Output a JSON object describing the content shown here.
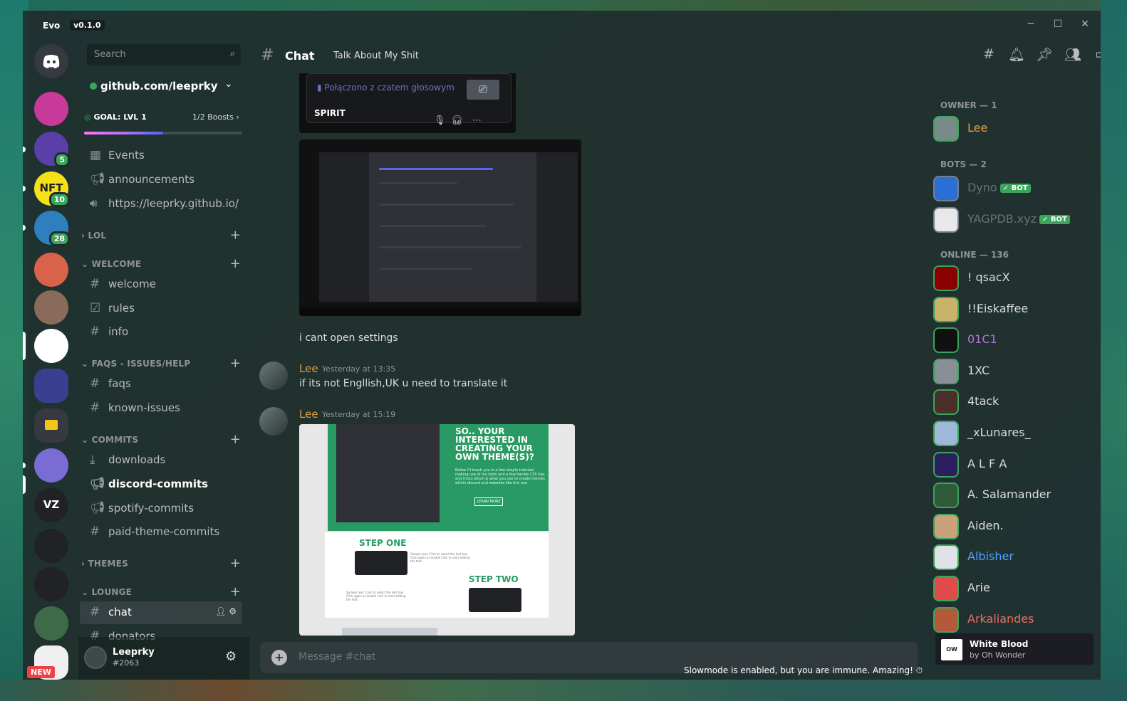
{
  "app": {
    "name": "Evo",
    "version": "v0.1.0"
  },
  "window_controls": {
    "minimize": "─",
    "maximize": "☐",
    "close": "✕"
  },
  "rail": {
    "home_icon": "discord-logo-icon",
    "servers": [
      {
        "name": "server-w",
        "color": "#c83a9a",
        "badge": ""
      },
      {
        "name": "server-night",
        "color": "#5b3fa8",
        "badge": "5"
      },
      {
        "name": "server-nft",
        "color": "#f5e11a",
        "badge": "10",
        "label": "NFT"
      },
      {
        "name": "server-calendar",
        "color": "#2f7fbf",
        "badge": "28"
      },
      {
        "name": "server-sunset",
        "color": "#d8634a",
        "badge": ""
      },
      {
        "name": "server-heroes",
        "color": "#8a6b5a",
        "badge": ""
      },
      {
        "name": "server-goose",
        "color": "#ffffff",
        "badge": ""
      },
      {
        "name": "server-folder",
        "color": "#3a3f8f",
        "badge": ""
      },
      {
        "name": "server-yellow-folder",
        "color": "#36393f",
        "badge": ""
      },
      {
        "name": "server-plug",
        "color": "#7a6bd5",
        "badge": ""
      },
      {
        "name": "server-vz",
        "color": "#202225",
        "badge": "",
        "label": "VZ"
      },
      {
        "name": "server-bd1",
        "color": "#202225",
        "badge": ""
      },
      {
        "name": "server-bd2",
        "color": "#202225",
        "badge": ""
      },
      {
        "name": "server-goose2",
        "color": "#3d6b4a",
        "badge": ""
      },
      {
        "name": "server-new",
        "color": "#f0f0f0",
        "badge": "NEW"
      }
    ]
  },
  "sidebar": {
    "search_placeholder": "Search",
    "server_name": "github.com/leeprky",
    "goal": "GOAL: LVL 1",
    "boosts": "1/2 Boosts",
    "goal_progress": 0.5,
    "channels": [
      {
        "icon": "▤",
        "label": "Events",
        "style": ""
      },
      {
        "icon": "📢",
        "label": "announcements",
        "style": ""
      },
      {
        "icon": "🔊",
        "label": "https://leeprky.github.io/",
        "style": ""
      }
    ],
    "categories": {
      "lol": "LOL",
      "welcome": "WELCOME",
      "faqs": "FAQS - ISSUES/HELP",
      "commits": "COMMITS",
      "themes": "THEMES",
      "lounge": "LOUNGE"
    },
    "welcome_channels": [
      "welcome",
      "rules",
      "info"
    ],
    "faq_channels": [
      "faqs",
      "known-issues"
    ],
    "commit_channels": [
      "downloads",
      "discord-commits",
      "spotify-commits",
      "paid-theme-commits"
    ],
    "lounge_channels": [
      "chat",
      "donators"
    ]
  },
  "user": {
    "name": "Leeprky",
    "tag": "#2063"
  },
  "header": {
    "title": "Chat",
    "topic": "Talk About My Shit"
  },
  "messages": {
    "voice_embed_status": "Połączono z czatem głosowym",
    "voice_embed_name": "SPIRIT",
    "text1": "i cant open settings",
    "author": "Lee",
    "time1": "Yesterday at 13:35",
    "text2": "if its not Engllish,UK u need to translate it",
    "time2": "Yesterday at 15:19",
    "shot2": {
      "headline": "SO.. YOUR INTERESTED IN CREATING YOUR OWN THEME(S)?",
      "body": "Below I'll teach you in a few simple tutorials making use of my tools and a few handle CSS tips and tricks which is what you use to create themes within discord and websites like this one",
      "button": "LEARN MORE",
      "step1": "STEP ONE",
      "step2": "STEP TWO",
      "sample": "Sample text. Click to select the text box. Click again or double click to start editing the text."
    }
  },
  "composer": {
    "placeholder": "Message #chat"
  },
  "slowmode": "Slowmode is enabled, but you are immune. Amazing!",
  "members": {
    "owner_header": "OWNER — 1",
    "bots_header": "BOTS — 2",
    "online_header": "ONLINE — 136",
    "bot_label": "✓ BOT",
    "owner": [
      {
        "name": "Lee",
        "color": "#e0a040"
      }
    ],
    "bots": [
      {
        "name": "Dyno",
        "color": "#6a7174"
      },
      {
        "name": "YAGPDB.xyz",
        "color": "#6a7174"
      }
    ],
    "online": [
      {
        "name": "! qsacX",
        "color": "#dcddde"
      },
      {
        "name": "!!Eiskaffee",
        "color": "#dcddde"
      },
      {
        "name": "01C1",
        "color": "#b56fd8"
      },
      {
        "name": "1XC",
        "color": "#dcddde"
      },
      {
        "name": "4tack",
        "color": "#dcddde"
      },
      {
        "name": "_xLunares_",
        "color": "#dcddde"
      },
      {
        "name": "A L F A",
        "color": "#dcddde"
      },
      {
        "name": "A. Salamander",
        "color": "#dcddde"
      },
      {
        "name": "Aiden.",
        "color": "#dcddde"
      },
      {
        "name": "Albisher",
        "color": "#4aa3ff"
      },
      {
        "name": "Arie",
        "color": "#dcddde"
      },
      {
        "name": "Arkaliandes",
        "color": "#f26c5c"
      }
    ]
  },
  "now_playing": {
    "title": "White Blood",
    "artist": "by Oh Wonder",
    "logo": "OW"
  }
}
